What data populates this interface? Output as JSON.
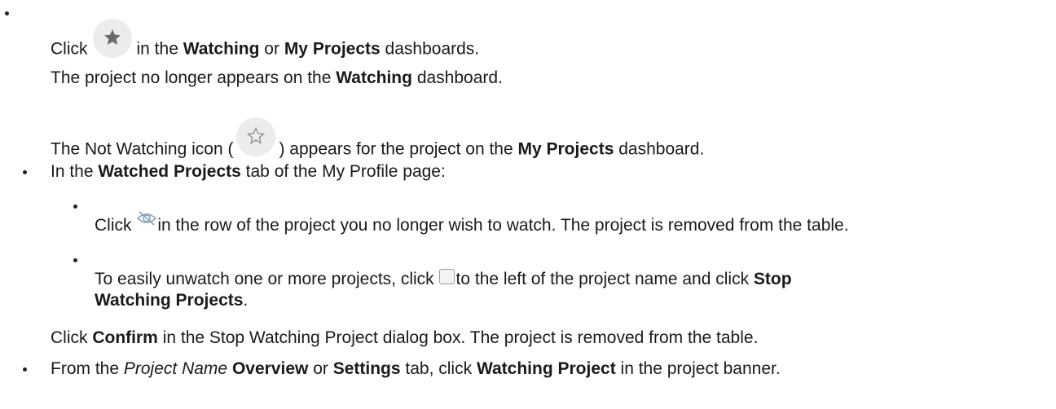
{
  "list": {
    "item1": {
      "line1": {
        "prefix": "Click",
        "icon": "star-filled-icon",
        "middle": "in the",
        "b1": "Watching",
        "or": "or",
        "b2": "My Projects",
        "suffix": "dashboards."
      },
      "line2": {
        "prefix": "The project no longer appears on the",
        "b1": "Watching",
        "suffix": "dashboard."
      },
      "line3": {
        "prefix": "The Not Watching icon (",
        "icon": "star-outline-icon",
        "middle": ") appears for the project on the",
        "b1": "My Projects",
        "suffix": "dashboard."
      }
    },
    "item2": {
      "intro": {
        "prefix": "In the",
        "b1": "Watched Projects",
        "suffix": "tab of the My Profile page:"
      },
      "sub1": {
        "prefix": "Click",
        "icon": "eye-slash-icon",
        "suffix": "in the row of the project you no longer wish to watch. The project is removed from the table."
      },
      "sub2": {
        "prefix": "To easily unwatch one or more projects, click",
        "icon": "checkbox-icon",
        "middle": "to the left of the project name and click",
        "b1": "Stop",
        "b2": "Watching Projects",
        "end": "."
      },
      "confirm": {
        "prefix": "Click",
        "b1": "Confirm",
        "suffix": "in the Stop Watching Project dialog box. The project is removed from the table."
      }
    },
    "item3": {
      "prefix": "From the",
      "i1": "Project Name",
      "b1": "Overview",
      "or": "or",
      "b2": "Settings",
      "middle": "tab, click",
      "b3": "Watching Project",
      "suffix": "in the project banner."
    }
  }
}
